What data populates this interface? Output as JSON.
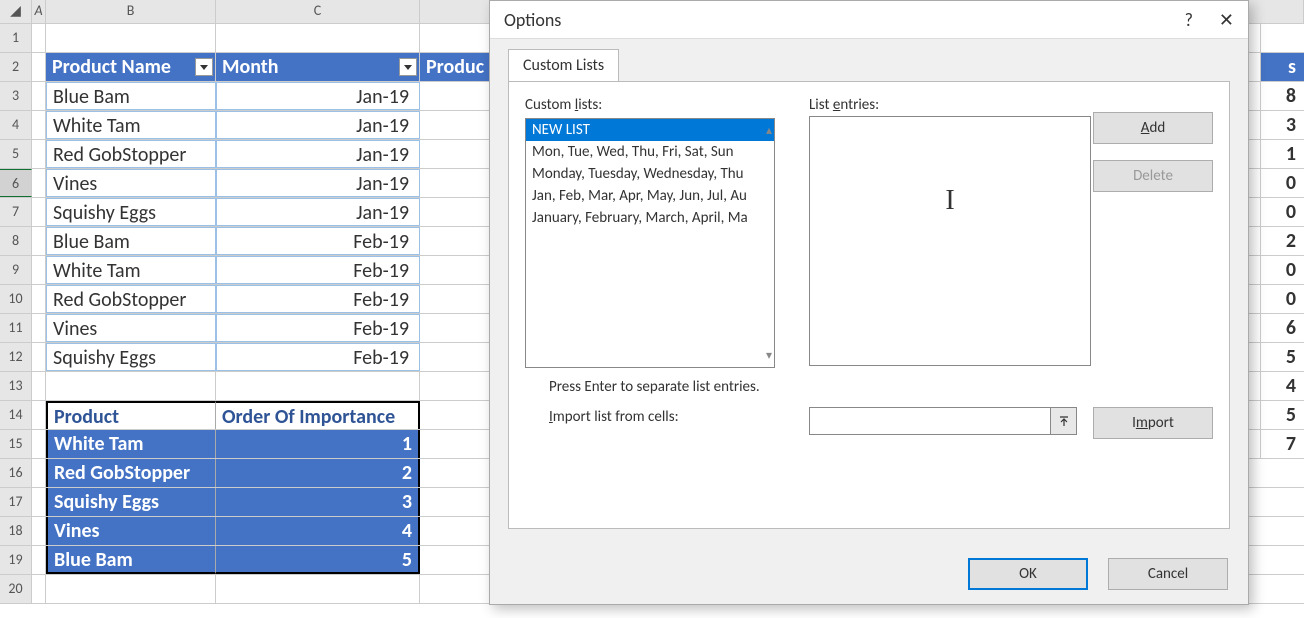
{
  "sheet": {
    "colA": "A",
    "colB": "B",
    "colC": "C",
    "headers": {
      "product_name": "Product Name",
      "month": "Month",
      "produc": "Produc"
    },
    "rows": [
      {
        "n": "1"
      },
      {
        "n": "2"
      },
      {
        "n": "3",
        "b": "Blue Bam",
        "c": "Jan-19"
      },
      {
        "n": "4",
        "b": "White Tam",
        "c": "Jan-19"
      },
      {
        "n": "5",
        "b": "Red GobStopper",
        "c": "Jan-19"
      },
      {
        "n": "6",
        "b": "Vines",
        "c": "Jan-19"
      },
      {
        "n": "7",
        "b": "Squishy Eggs",
        "c": "Jan-19"
      },
      {
        "n": "8",
        "b": "Blue Bam",
        "c": "Feb-19"
      },
      {
        "n": "9",
        "b": "White Tam",
        "c": "Feb-19"
      },
      {
        "n": "10",
        "b": "Red GobStopper",
        "c": "Feb-19"
      },
      {
        "n": "11",
        "b": "Vines",
        "c": "Feb-19"
      },
      {
        "n": "12",
        "b": "Squishy Eggs",
        "c": "Feb-19"
      },
      {
        "n": "13"
      },
      {
        "n": "14"
      },
      {
        "n": "15"
      },
      {
        "n": "16"
      },
      {
        "n": "17"
      },
      {
        "n": "18"
      },
      {
        "n": "19"
      },
      {
        "n": "20"
      }
    ],
    "lower": {
      "h1": "Product",
      "h2": "Order Of Importance",
      "rows": [
        {
          "p": "White Tam",
          "o": "1"
        },
        {
          "p": "Red GobStopper",
          "o": "2"
        },
        {
          "p": "Squishy Eggs",
          "o": "3"
        },
        {
          "p": "Vines",
          "o": "4"
        },
        {
          "p": "Blue Bam",
          "o": "5"
        }
      ]
    }
  },
  "rightpeek": {
    "head": "s",
    "vals": [
      "8",
      "3",
      "1",
      "0",
      "0",
      "2",
      "0",
      "0",
      "6",
      "5",
      "4",
      "5",
      "7"
    ]
  },
  "dialog": {
    "title": "Options",
    "help": "?",
    "close": "✕",
    "tab": "Custom Lists",
    "custom_label": "Custom lists:",
    "custom_key": "l",
    "entries_label": "List entries:",
    "entries_key": "e",
    "list_items": [
      "NEW LIST",
      "Mon, Tue, Wed, Thu, Fri, Sat, Sun",
      "Monday, Tuesday, Wednesday, Thu",
      "Jan, Feb, Mar, Apr, May, Jun, Jul, Au",
      "January, February, March, April, Ma"
    ],
    "hint": "Press Enter to separate list entries.",
    "import_label": "Import list from cells:",
    "import_key": "I",
    "btn_add": "Add",
    "btn_add_key": "A",
    "btn_delete": "Delete",
    "btn_import": "Import",
    "btn_import_key": "m",
    "btn_ok": "OK",
    "btn_cancel": "Cancel"
  }
}
